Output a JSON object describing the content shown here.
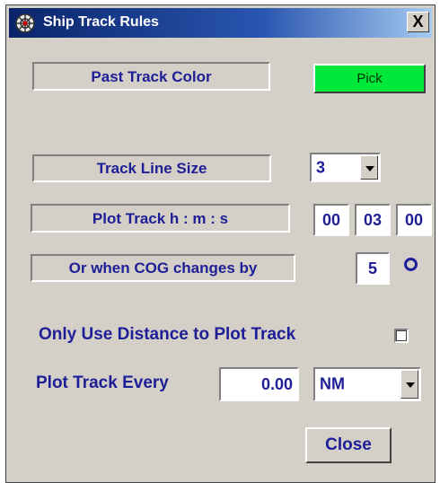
{
  "window": {
    "title": "Ship Track Rules",
    "close_label": "X"
  },
  "track_color": {
    "label": "Past Track Color",
    "button_label": "Pick",
    "current_color": "#00e83a"
  },
  "line_size": {
    "label": "Track Line Size",
    "value": "3"
  },
  "plot_interval": {
    "label": "Plot Track  h : m : s",
    "hours": "00",
    "minutes": "03",
    "seconds": "00"
  },
  "cog_change": {
    "label": "Or when COG changes by",
    "value": "5",
    "unit_icon": "degree-symbol"
  },
  "distance_only": {
    "label": "Only Use Distance to Plot Track",
    "checked": false
  },
  "plot_every": {
    "label": "Plot Track Every",
    "value": "0.00",
    "unit": "NM"
  },
  "footer": {
    "close_label": "Close"
  },
  "colors": {
    "label_text": "#1e1e96",
    "window_bg": "#d4d0c8",
    "title_bar": "#0a246a"
  }
}
